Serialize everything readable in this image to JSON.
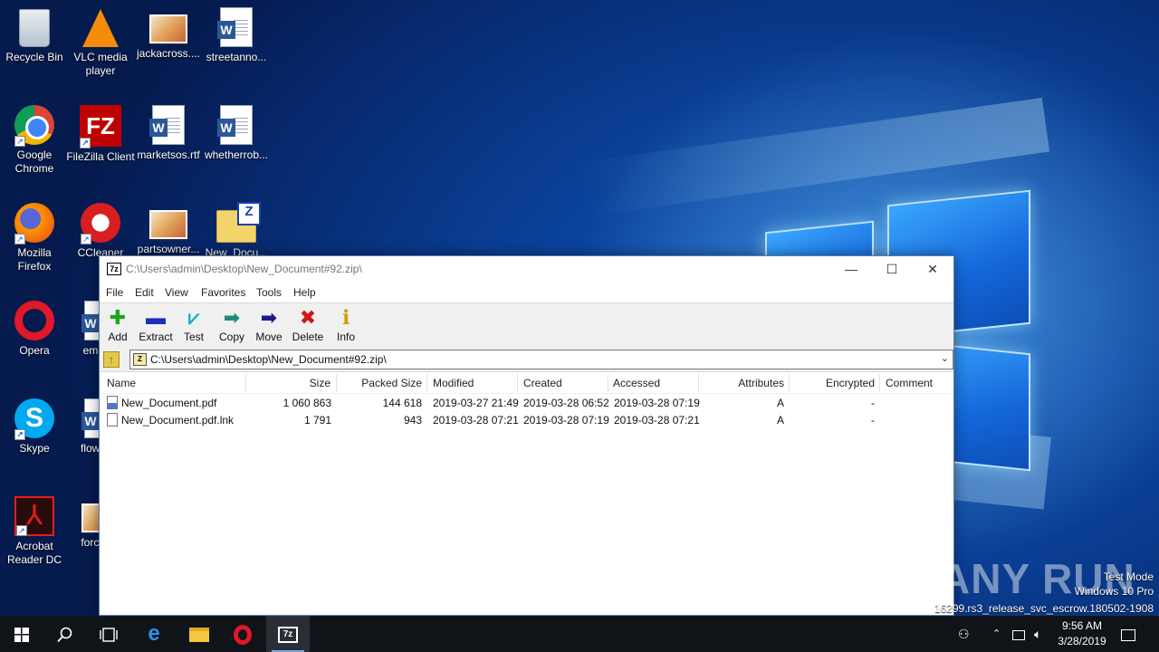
{
  "desktop": {
    "icons": [
      {
        "label": "Recycle Bin"
      },
      {
        "label": "VLC media player"
      },
      {
        "label": "jackacross...."
      },
      {
        "label": "streetanno..."
      },
      {
        "label": "Google Chrome"
      },
      {
        "label": "FileZilla Client"
      },
      {
        "label": "marketsos.rtf"
      },
      {
        "label": "whetherrob..."
      },
      {
        "label": "Mozilla Firefox"
      },
      {
        "label": "CCleaner"
      },
      {
        "label": "partsowner..."
      },
      {
        "label": "New_Docu..."
      },
      {
        "label": "Opera"
      },
      {
        "label": "email..."
      },
      {
        "label": "Skype"
      },
      {
        "label": "flowse..."
      },
      {
        "label": "Acrobat Reader DC"
      },
      {
        "label": "forcee..."
      }
    ]
  },
  "window": {
    "title": "C:\\Users\\admin\\Desktop\\New_Document#92.zip\\",
    "app_icon": "7z",
    "controls": {
      "minimize": "—",
      "maximize": "☐",
      "close": "✕"
    },
    "menu": [
      "File",
      "Edit",
      "View",
      "Favorites",
      "Tools",
      "Help"
    ],
    "toolbar": [
      {
        "label": "Add",
        "icon": "plus-icon",
        "glyph": "✚",
        "color": "#1aa51a"
      },
      {
        "label": "Extract",
        "icon": "minus-icon",
        "glyph": "▬",
        "color": "#1a2fbf"
      },
      {
        "label": "Test",
        "icon": "check-icon",
        "glyph": "⩗",
        "color": "#19b3c4"
      },
      {
        "label": "Copy",
        "icon": "copy-arrow-icon",
        "glyph": "➡",
        "color": "#1b8c7a"
      },
      {
        "label": "Move",
        "icon": "move-arrow-icon",
        "glyph": "➡",
        "color": "#1a1a8c"
      },
      {
        "label": "Delete",
        "icon": "delete-x-icon",
        "glyph": "✖",
        "color": "#d01818"
      },
      {
        "label": "Info",
        "icon": "info-icon",
        "glyph": "ℹ",
        "color": "#c9a000"
      }
    ],
    "address": {
      "path": "C:\\Users\\admin\\Desktop\\New_Document#92.zip\\"
    },
    "columns": [
      "Name",
      "Size",
      "Packed Size",
      "Modified",
      "Created",
      "Accessed",
      "Attributes",
      "Encrypted",
      "Comment"
    ],
    "rows": [
      {
        "name": "New_Document.pdf",
        "size": "1 060 863",
        "packed": "144 618",
        "modified": "2019-03-27 21:49",
        "created": "2019-03-28 06:52",
        "accessed": "2019-03-28 07:19",
        "attributes": "A",
        "encrypted": "-",
        "comment": ""
      },
      {
        "name": "New_Document.pdf.lnk",
        "size": "1 791",
        "packed": "943",
        "modified": "2019-03-28 07:21",
        "created": "2019-03-28 07:19",
        "accessed": "2019-03-28 07:21",
        "attributes": "A",
        "encrypted": "-",
        "comment": ""
      }
    ]
  },
  "taskbar": {
    "pinned": [
      "windows-start",
      "search",
      "task-view",
      "edge",
      "file-explorer",
      "opera",
      "7-zip"
    ],
    "active_app_label": "7z",
    "clock": {
      "time": "9:56 AM",
      "date": "3/28/2019"
    }
  },
  "watermark": {
    "brand": "ANY RUN",
    "line1": "Test Mode",
    "line2": "Windows 10 Pro",
    "line3": "16299.rs3_release_svc_escrow.180502-1908"
  }
}
